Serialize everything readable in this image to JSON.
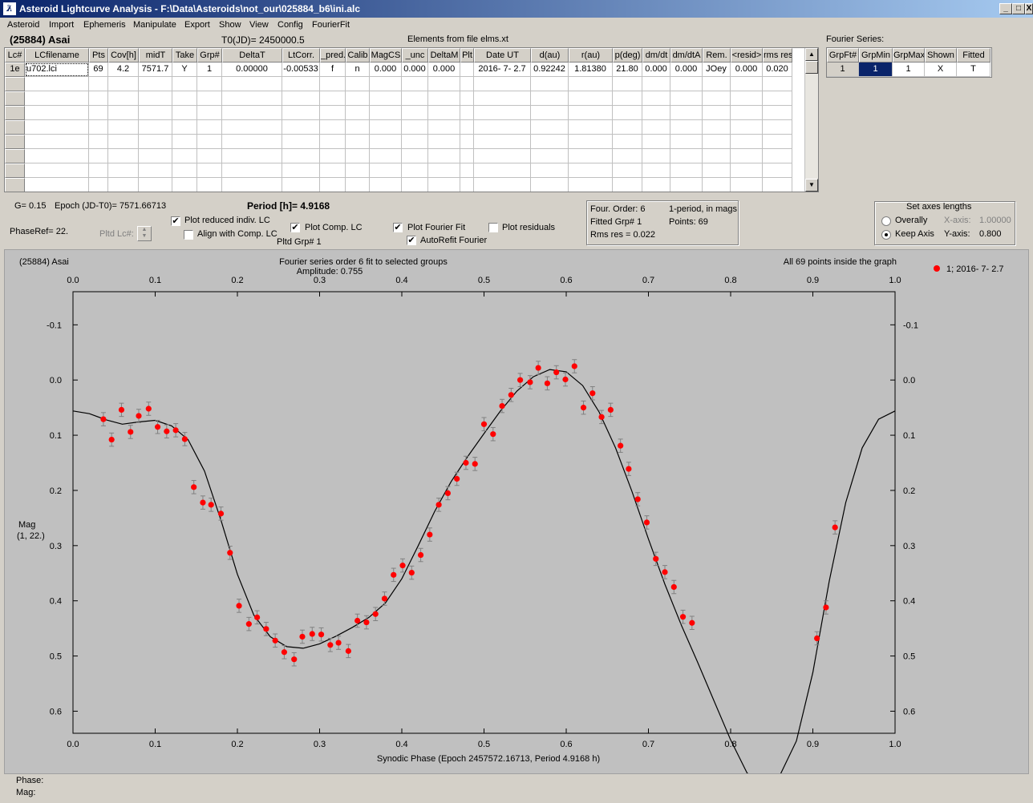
{
  "window": {
    "title": "Asteroid Lightcurve Analysis - F:\\Data\\Asteroids\\not_our\\025884_b6\\ini.alc",
    "minimize": "_",
    "maximize": "□",
    "close": "X"
  },
  "menu": [
    "Asteroid",
    "Import",
    "Ephemeris",
    "Manipulate",
    "Export",
    "Show",
    "View",
    "Config",
    "FourierFit"
  ],
  "header": {
    "asteroid_name": "(25884) Asai",
    "t0": "T0(JD)= 2450000.5",
    "elements": "Elements from file elms.xt",
    "fourier_series_label": "Fourier Series:"
  },
  "lc_grid": {
    "columns": [
      "Lc#",
      "LCfilename",
      "Pts",
      "Cov[h]",
      "midT",
      "Take",
      "Grp#",
      "DeltaT",
      "LtCorr.",
      "_pred.",
      "Calib",
      "MagCS",
      "_unc",
      "DeltaM",
      "Plt",
      "Date UT",
      "d(au)",
      "r(au)",
      "p(deg)",
      "dm/dt",
      "dm/dtA",
      "Rem.",
      "<resid>",
      "rms res"
    ],
    "rows": [
      [
        "1e",
        "u702.lci",
        "69",
        "4.2",
        "7571.7",
        "Y",
        "1",
        "0.00000",
        "-0.00533",
        "f",
        "n",
        "0.000",
        "0.000",
        "0.000",
        "",
        "2016- 7- 2.7",
        "0.92242",
        "1.81380",
        "21.80",
        "0.000",
        "0.000",
        "JOey",
        "0.000",
        "0.020"
      ]
    ]
  },
  "fs_grid": {
    "columns": [
      "GrpFt#",
      "GrpMin",
      "GrpMax",
      "Shown",
      "Fitted"
    ],
    "rows": [
      [
        "1",
        "1",
        "1",
        "X",
        "T"
      ]
    ]
  },
  "controls": {
    "g": "G= 0.15",
    "epoch": "Epoch (JD-T0)= 7571.66713",
    "period": "Period [h]= 4.9168",
    "phaseref": "PhaseRef= 22.",
    "pltd_lc": "Pltd Lc#:",
    "plot_reduced": "Plot reduced indiv. LC",
    "align_comp": "Align with Comp. LC",
    "plot_comp": "Plot Comp. LC",
    "pltd_grp": "Pltd Grp#  1",
    "plot_fourier": "Plot Fourier Fit",
    "autorefit": "AutoRefit Fourier",
    "plot_residuals": "Plot residuals",
    "four_order": "Four. Order:  6",
    "one_period": "1-period, in mags",
    "fitted_grp": "Fitted Grp# 1",
    "points": "Points: 69",
    "rms_res": "Rms res     = 0.022",
    "axes_title": "Set axes lengths",
    "overally": "Overally",
    "keep_axis": "Keep Axis",
    "x_axis_label": "X-axis:",
    "x_axis_value": "1.00000",
    "y_axis_label": "Y-axis:",
    "y_axis_value": "0.800",
    "checked": {
      "plot_reduced": true,
      "align_comp": false,
      "plot_comp": true,
      "plot_fourier": true,
      "autorefit": true,
      "plot_residuals": false
    },
    "check_mark": "✔"
  },
  "footer": {
    "phase": "Phase:",
    "mag": "Mag:"
  },
  "chart_data": {
    "type": "scatter",
    "title_left": "(25884) Asai",
    "title": "Fourier series order 6 fit to selected groups",
    "subtitle": "Amplitude: 0.755",
    "title_right": "All 69 points inside the graph",
    "xlabel": "Synodic Phase (Epoch 2457572.16713, Period 4.9168 h)",
    "ylabel": [
      "Mag",
      "(1, 22.)"
    ],
    "xlim": [
      0.0,
      1.0
    ],
    "ylim": [
      -0.16,
      0.64
    ],
    "y_inverted": true,
    "xticks": [
      "0.0",
      "0.1",
      "0.2",
      "0.3",
      "0.4",
      "0.5",
      "0.6",
      "0.7",
      "0.8",
      "0.9",
      "1.0"
    ],
    "yticks": [
      "-0.1",
      "0.0",
      "0.1",
      "0.2",
      "0.3",
      "0.4",
      "0.5",
      "0.6"
    ],
    "legend": "1; 2016- 7- 2.7",
    "legend_position": "top-right",
    "point_color": "#ff0000",
    "errorbar_color": "#808080",
    "fit_color": "#000000",
    "error": 0.012,
    "points": [
      [
        0.037,
        0.071
      ],
      [
        0.047,
        0.108
      ],
      [
        0.059,
        0.054
      ],
      [
        0.07,
        0.094
      ],
      [
        0.08,
        0.065
      ],
      [
        0.092,
        0.052
      ],
      [
        0.103,
        0.085
      ],
      [
        0.114,
        0.093
      ],
      [
        0.125,
        0.091
      ],
      [
        0.136,
        0.107
      ],
      [
        0.147,
        0.194
      ],
      [
        0.158,
        0.222
      ],
      [
        0.168,
        0.226
      ],
      [
        0.18,
        0.242
      ],
      [
        0.191,
        0.313
      ],
      [
        0.202,
        0.409
      ],
      [
        0.214,
        0.442
      ],
      [
        0.224,
        0.43
      ],
      [
        0.235,
        0.451
      ],
      [
        0.246,
        0.472
      ],
      [
        0.257,
        0.493
      ],
      [
        0.269,
        0.506
      ],
      [
        0.279,
        0.465
      ],
      [
        0.291,
        0.46
      ],
      [
        0.302,
        0.461
      ],
      [
        0.313,
        0.48
      ],
      [
        0.323,
        0.476
      ],
      [
        0.335,
        0.491
      ],
      [
        0.346,
        0.436
      ],
      [
        0.357,
        0.439
      ],
      [
        0.368,
        0.424
      ],
      [
        0.379,
        0.396
      ],
      [
        0.39,
        0.353
      ],
      [
        0.401,
        0.336
      ],
      [
        0.412,
        0.349
      ],
      [
        0.423,
        0.317
      ],
      [
        0.434,
        0.28
      ],
      [
        0.445,
        0.226
      ],
      [
        0.456,
        0.205
      ],
      [
        0.467,
        0.179
      ],
      [
        0.478,
        0.15
      ],
      [
        0.489,
        0.152
      ],
      [
        0.5,
        0.08
      ],
      [
        0.511,
        0.098
      ],
      [
        0.522,
        0.047
      ],
      [
        0.533,
        0.027
      ],
      [
        0.544,
        0.0
      ],
      [
        0.556,
        0.004
      ],
      [
        0.566,
        -0.022
      ],
      [
        0.577,
        0.006
      ],
      [
        0.588,
        -0.014
      ],
      [
        0.599,
        -0.001
      ],
      [
        0.61,
        -0.025
      ],
      [
        0.621,
        0.05
      ],
      [
        0.632,
        0.024
      ],
      [
        0.643,
        0.067
      ],
      [
        0.654,
        0.054
      ],
      [
        0.666,
        0.119
      ],
      [
        0.676,
        0.161
      ],
      [
        0.687,
        0.216
      ],
      [
        0.698,
        0.258
      ],
      [
        0.709,
        0.324
      ],
      [
        0.72,
        0.348
      ],
      [
        0.731,
        0.375
      ],
      [
        0.742,
        0.429
      ],
      [
        0.753,
        0.44
      ],
      [
        0.905,
        0.468
      ],
      [
        0.916,
        0.412
      ],
      [
        0.927,
        0.267
      ]
    ],
    "fit_curve": [
      [
        0.0,
        0.056
      ],
      [
        0.02,
        0.061
      ],
      [
        0.04,
        0.072
      ],
      [
        0.06,
        0.08
      ],
      [
        0.08,
        0.076
      ],
      [
        0.1,
        0.073
      ],
      [
        0.12,
        0.083
      ],
      [
        0.14,
        0.108
      ],
      [
        0.16,
        0.165
      ],
      [
        0.18,
        0.254
      ],
      [
        0.2,
        0.352
      ],
      [
        0.22,
        0.426
      ],
      [
        0.24,
        0.465
      ],
      [
        0.26,
        0.483
      ],
      [
        0.28,
        0.486
      ],
      [
        0.3,
        0.478
      ],
      [
        0.32,
        0.464
      ],
      [
        0.34,
        0.448
      ],
      [
        0.36,
        0.43
      ],
      [
        0.38,
        0.404
      ],
      [
        0.4,
        0.36
      ],
      [
        0.42,
        0.3
      ],
      [
        0.44,
        0.238
      ],
      [
        0.46,
        0.184
      ],
      [
        0.48,
        0.139
      ],
      [
        0.5,
        0.097
      ],
      [
        0.52,
        0.056
      ],
      [
        0.54,
        0.02
      ],
      [
        0.56,
        -0.006
      ],
      [
        0.58,
        -0.019
      ],
      [
        0.6,
        -0.015
      ],
      [
        0.62,
        0.01
      ],
      [
        0.64,
        0.058
      ],
      [
        0.66,
        0.123
      ],
      [
        0.68,
        0.202
      ],
      [
        0.7,
        0.288
      ],
      [
        0.72,
        0.37
      ],
      [
        0.74,
        0.444
      ],
      [
        0.76,
        0.512
      ],
      [
        0.78,
        0.582
      ],
      [
        0.8,
        0.652
      ],
      [
        0.82,
        0.712
      ],
      [
        0.84,
        0.735
      ],
      [
        0.86,
        0.716
      ],
      [
        0.88,
        0.654
      ],
      [
        0.9,
        0.53
      ],
      [
        0.92,
        0.364
      ],
      [
        0.94,
        0.222
      ],
      [
        0.96,
        0.123
      ],
      [
        0.98,
        0.071
      ],
      [
        1.0,
        0.056
      ]
    ]
  }
}
